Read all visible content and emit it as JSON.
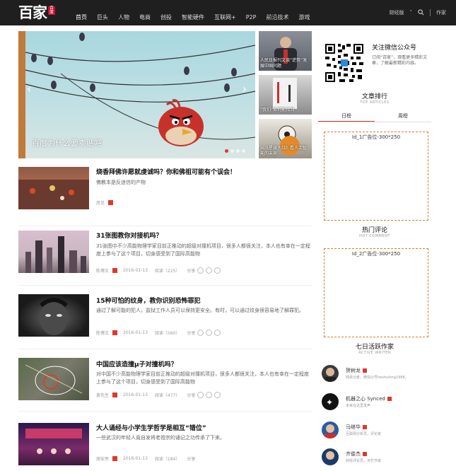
{
  "header": {
    "logo_text": "百家",
    "logo_seal": "百度",
    "nav": [
      "首页",
      "巨头",
      "人物",
      "电商",
      "创投",
      "智能硬件",
      "互联网+",
      "P2P",
      "前沿技术",
      "游戏"
    ],
    "right": {
      "finance": "财经版",
      "author": "作家"
    }
  },
  "carousel": {
    "caption": "百度为什么要卖贴吧",
    "arrow_left": "‹",
    "arrow_right": "›",
    "thumbs": [
      {
        "caption": "人民日报刊文谈“逆势”发展中国问题"
      },
      {
        "caption": "“我们”如何能找到"
      },
      {
        "caption": "从《星球大战》看人工智能的未来"
      }
    ]
  },
  "articles": [
    {
      "title": "烧香拜佛许愿就虔诚吗？你和佛祖可能有个误会！",
      "summary": "佛教本是反迷信的产物",
      "author": "房见",
      "date": "",
      "reads": "",
      "share": "",
      "partial": true
    },
    {
      "title": "31张图教你对接机吗？",
      "summary": "31张图中不少高能物理学家目前正推动的超级对撞机项目，很多人都很关注，本人也有幸在一定程度上参与了这个项目，切身感受到了国际高能物",
      "author": "陈博文",
      "date": "2016-01-13",
      "reads": "阅读（225）",
      "share": "分享"
    },
    {
      "title": "15种可怕的纹身，教你识别恐怖罪犯",
      "summary": "通过了解可能的犯人，监狱工作人员可以保持更安全。有时，可以通过纹身很容易地了解罪犯。",
      "author": "陈博文",
      "date": "2016-01-13",
      "reads": "阅读（560）",
      "share": "分享"
    },
    {
      "title": "中国应该造撞μ子对撞机吗？",
      "summary": "对中国不少高能物理学家目前正推动的超级对撞机项目，很多人都很关注，本人也有幸在一定程度上参与了这个项目，切身感受到了国际高能物",
      "author": "袁先生",
      "date": "2016-01-13",
      "reads": "阅读（477）",
      "share": "分享"
    },
    {
      "title": "大人诵经与小学生学哲学是相互“错位”",
      "summary": "一些武汉的年轻人竟自发将老祖宗的诵记之功传承了下来。",
      "author": "周安亮",
      "date": "2016-01-13",
      "reads": "阅读（184）",
      "share": "分享"
    }
  ],
  "sidebar": {
    "wechat_title": "关注微信公众号",
    "wechat_desc": "订阅“百家”，观看更多精彩文章，了解最新精彩内容。",
    "rank_title": "文章排行",
    "rank_sub": "TOP ARTICLES",
    "tabs": [
      "日榜",
      "周榜"
    ],
    "ad1": "Id_1广告位-300*250",
    "hot_title": "热门评论",
    "hot_sub": "HOT COMMENT",
    "ad2": "Id_2广告位-300*250",
    "active_title": "七日活跃作家",
    "active_sub": "ACTIVE WRITER",
    "writers": [
      {
        "name": "贺树龙",
        "desc": "网易记者，微信公号heshulong1988。"
      },
      {
        "name": "机器之心 Synced",
        "desc": "未来在这里发声"
      },
      {
        "name": "马继华",
        "desc": "互联网分析员，评论家"
      },
      {
        "name": "齐俊杰",
        "desc": "财经评论员，专栏作家"
      }
    ]
  },
  "colors": {
    "accent": "#e0382a",
    "topbar": "#1f1f1f",
    "ad_border": "#e07a1e"
  }
}
